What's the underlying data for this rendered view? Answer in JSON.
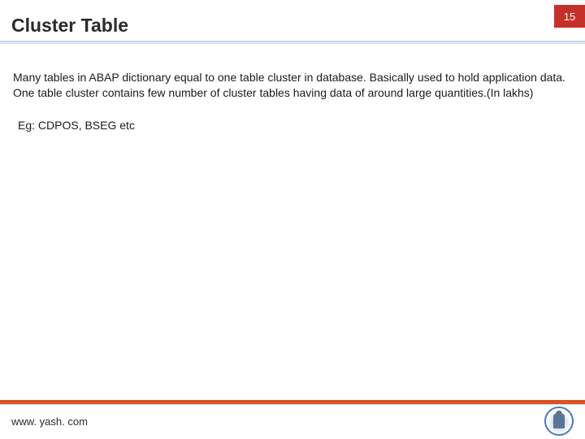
{
  "header": {
    "title": "Cluster Table",
    "page_number": "15"
  },
  "content": {
    "body": "Many tables in ABAP dictionary equal to one table cluster in database. Basically used to hold application data. One table cluster contains few number of cluster tables having data of around large quantities.(In lakhs)",
    "example": "Eg: CDPOS, BSEG etc"
  },
  "footer": {
    "url": "www. yash. com"
  }
}
